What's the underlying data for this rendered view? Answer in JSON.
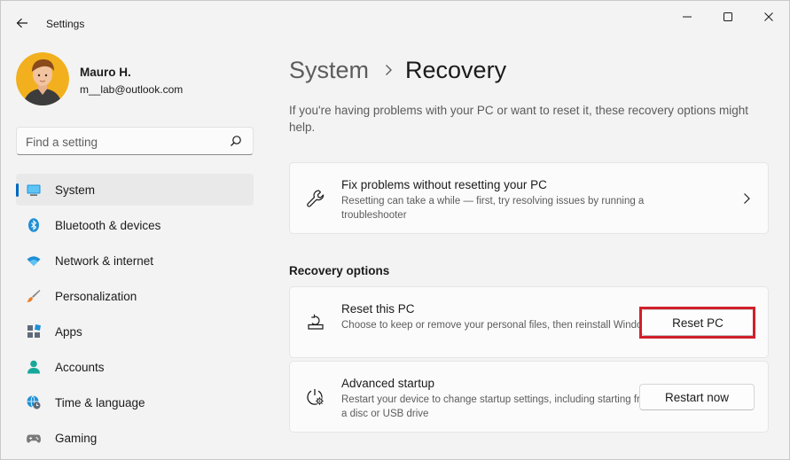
{
  "window": {
    "title": "Settings"
  },
  "profile": {
    "name": "Mauro H.",
    "email": "m__lab@outlook.com"
  },
  "search": {
    "placeholder": "Find a setting"
  },
  "sidebar": {
    "items": [
      {
        "label": "System",
        "icon": "system-icon",
        "active": true
      },
      {
        "label": "Bluetooth & devices",
        "icon": "bluetooth-icon"
      },
      {
        "label": "Network & internet",
        "icon": "wifi-icon"
      },
      {
        "label": "Personalization",
        "icon": "brush-icon"
      },
      {
        "label": "Apps",
        "icon": "apps-icon"
      },
      {
        "label": "Accounts",
        "icon": "accounts-icon"
      },
      {
        "label": "Time & language",
        "icon": "globe-clock-icon"
      },
      {
        "label": "Gaming",
        "icon": "gamepad-icon"
      }
    ]
  },
  "main": {
    "breadcrumb_parent": "System",
    "breadcrumb_current": "Recovery",
    "description": "If you're having problems with your PC or want to reset it, these recovery options might help.",
    "fix_card": {
      "title": "Fix problems without resetting your PC",
      "subtitle": "Resetting can take a while — first, try resolving issues by running a troubleshooter"
    },
    "section_title": "Recovery options",
    "reset_card": {
      "title": "Reset this PC",
      "subtitle": "Choose to keep or remove your personal files, then reinstall Windows",
      "button": "Reset PC"
    },
    "advanced_card": {
      "title": "Advanced startup",
      "subtitle": "Restart your device to change startup settings, including starting from a disc or USB drive",
      "button": "Restart now"
    }
  },
  "colors": {
    "accent": "#0067c0",
    "highlight": "#d0202a",
    "background": "#f3f3f3",
    "card": "#fbfbfb"
  }
}
